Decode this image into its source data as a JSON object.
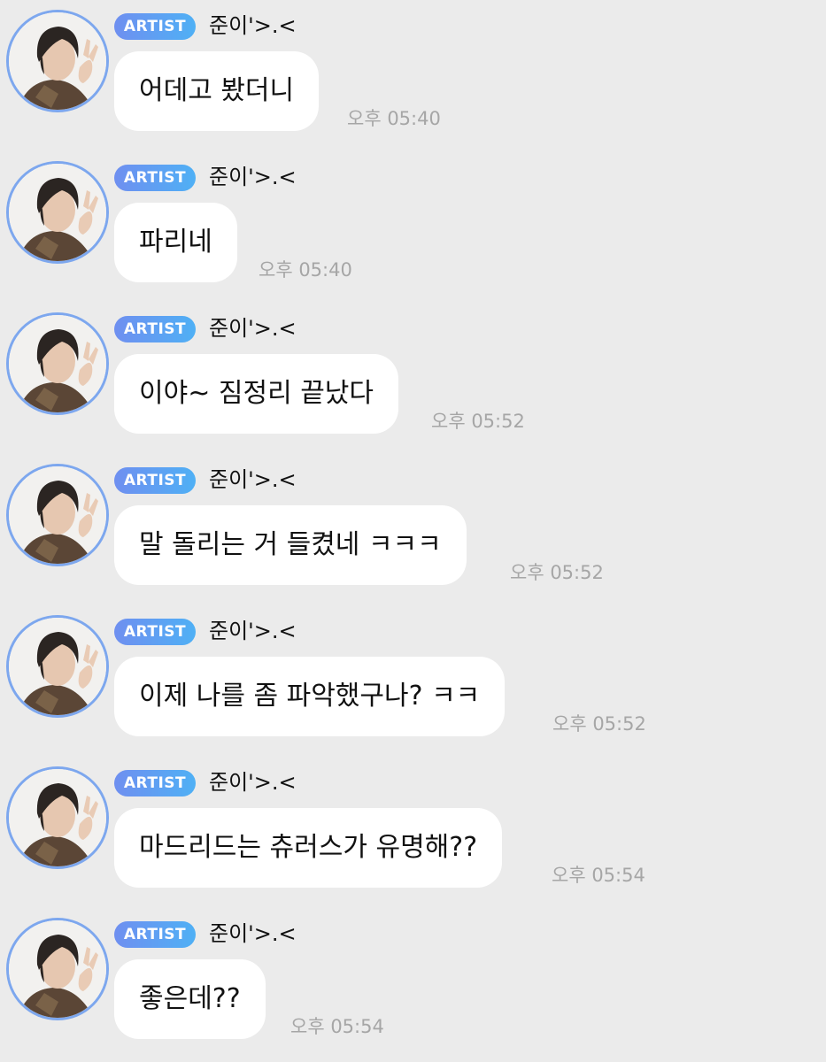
{
  "messages": [
    {
      "badge": "ARTIST",
      "sender": "준이'>.<",
      "text": "어데고 봤더니",
      "time": "오후 05:40"
    },
    {
      "badge": "ARTIST",
      "sender": "준이'>.<",
      "text": "파리네",
      "time": "오후 05:40"
    },
    {
      "badge": "ARTIST",
      "sender": "준이'>.<",
      "text": "이야~ 짐정리 끝났다",
      "time": "오후 05:52"
    },
    {
      "badge": "ARTIST",
      "sender": "준이'>.<",
      "text": "말 돌리는 거 들켰네 ㅋㅋㅋ",
      "time": "오후 05:52"
    },
    {
      "badge": "ARTIST",
      "sender": "준이'>.<",
      "text": "이제 나를 좀 파악했구나? ㅋㅋ",
      "time": "오후 05:52"
    },
    {
      "badge": "ARTIST",
      "sender": "준이'>.<",
      "text": "마드리드는 츄러스가 유명해??",
      "time": "오후 05:54"
    },
    {
      "badge": "ARTIST",
      "sender": "준이'>.<",
      "text": "좋은데??",
      "time": "오후 05:54"
    }
  ],
  "colors": {
    "background": "#ebebeb",
    "bubble": "#ffffff",
    "badge_start": "#6f8ff0",
    "badge_end": "#4fb0f5",
    "avatar_ring": "#7da7ee",
    "time_text": "#a6a6a6"
  },
  "icons": {
    "avatar": "artist-profile-photo"
  }
}
